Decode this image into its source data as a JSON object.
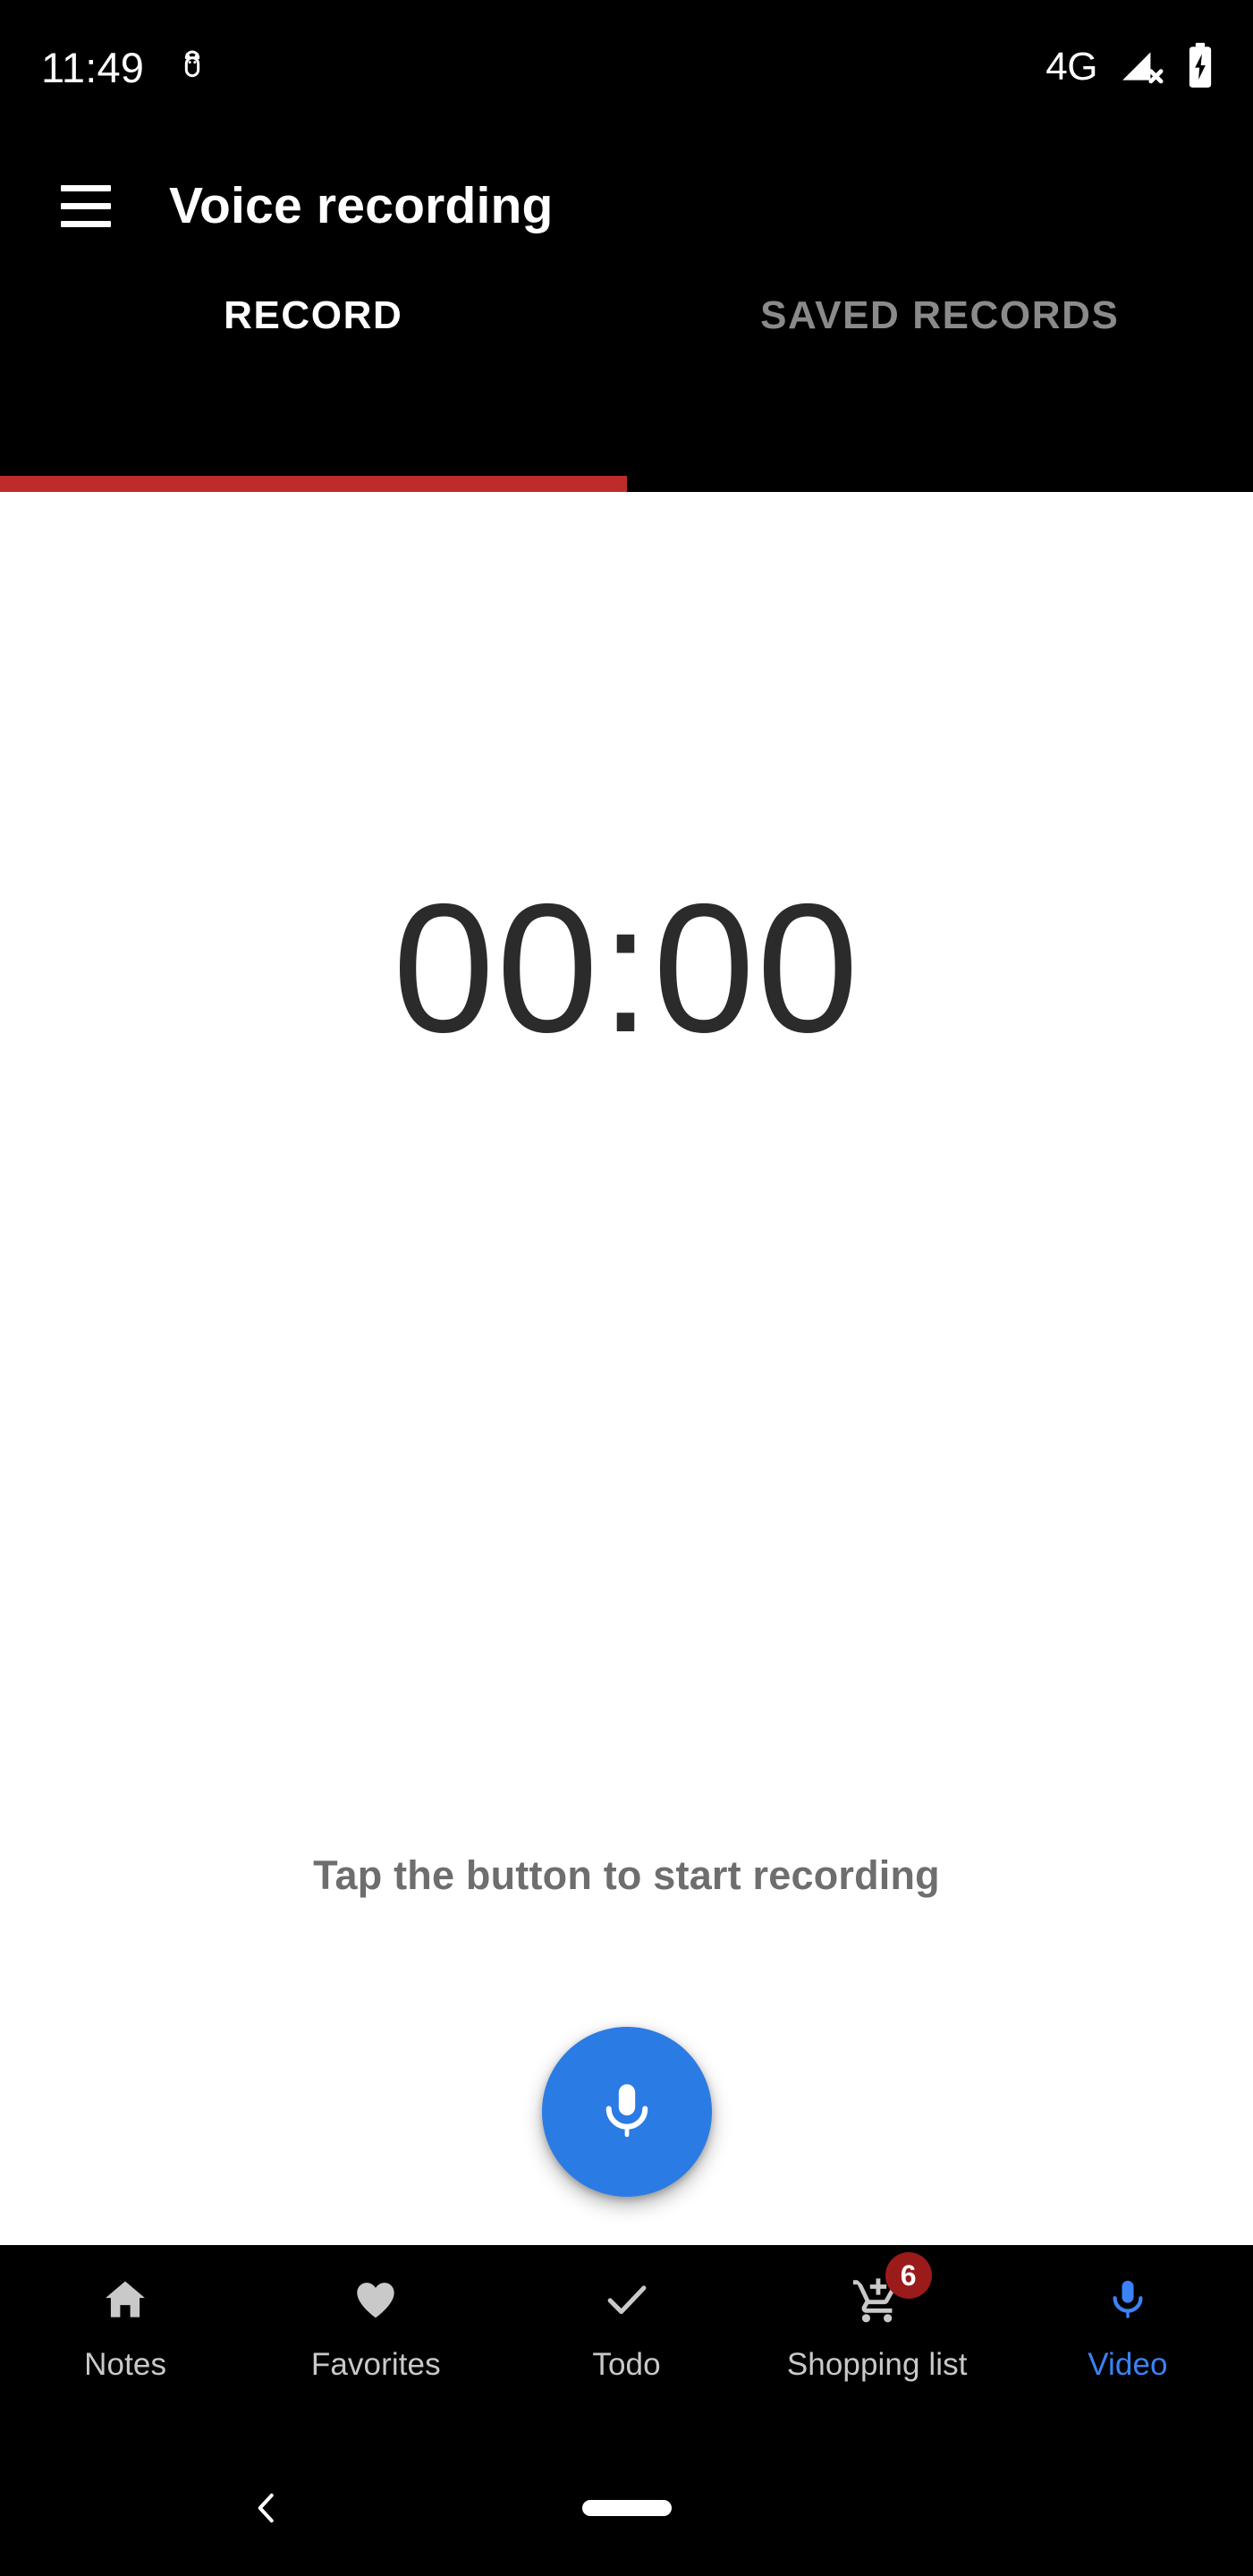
{
  "status_bar": {
    "clock": "11:49",
    "debug_icon": "android-bug-icon",
    "network_type": "4G",
    "signal_icon": "signal-no-connection-icon",
    "battery_icon": "battery-charging-icon"
  },
  "app_bar": {
    "menu_icon": "hamburger-menu-icon",
    "title": "Voice recording"
  },
  "tabs": {
    "active_index": 0,
    "indicator_color": "#bf2b2b",
    "items": [
      {
        "label": "RECORD",
        "active": true
      },
      {
        "label": "SAVED RECORDS",
        "active": false
      }
    ]
  },
  "content": {
    "timer": "00:00",
    "hint": "Tap the button to start recording",
    "fab": {
      "icon": "microphone-icon",
      "color": "#2b7be4",
      "icon_color": "#ffffff"
    }
  },
  "bottom_nav": {
    "active_color": "#3b82f6",
    "inactive_color": "#c9c9c9",
    "badge_color": "#9b1b1b",
    "items": [
      {
        "label": "Notes",
        "icon": "home-icon",
        "active": false,
        "badge": ""
      },
      {
        "label": "Favorites",
        "icon": "heart-icon",
        "active": false,
        "badge": ""
      },
      {
        "label": "Todo",
        "icon": "check-icon",
        "active": false,
        "badge": ""
      },
      {
        "label": "Shopping list",
        "icon": "add-shopping-cart-icon",
        "active": false,
        "badge": "6"
      },
      {
        "label": "Video",
        "icon": "microphone-icon",
        "active": true,
        "badge": ""
      }
    ]
  },
  "system_nav": {
    "back_icon": "back-chevron-icon",
    "home_icon": "home-pill-indicator"
  }
}
